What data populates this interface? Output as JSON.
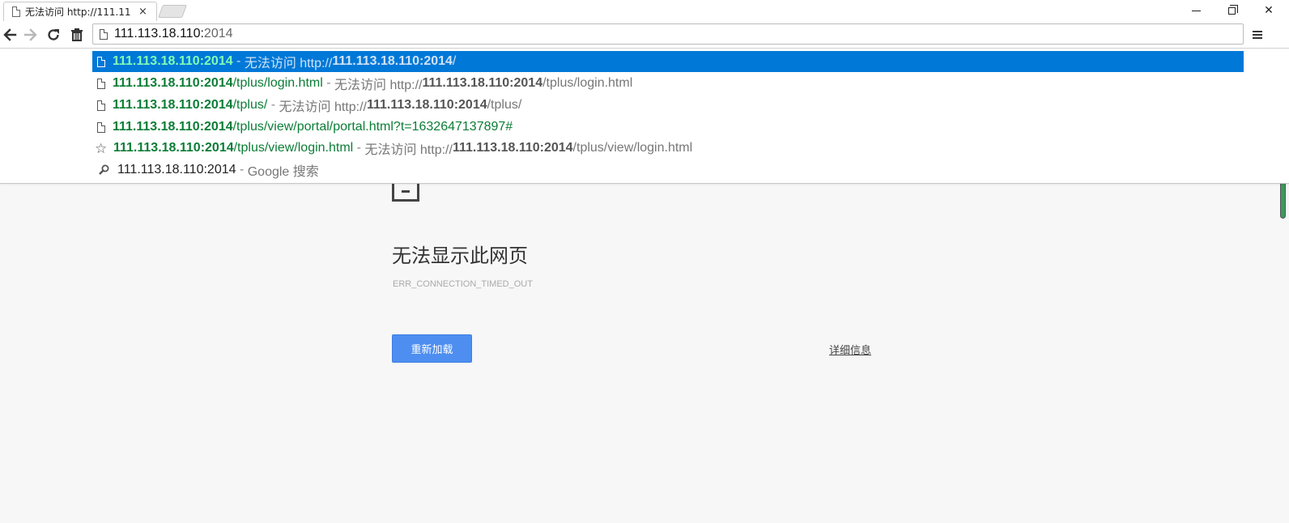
{
  "tab": {
    "title": "无法访问 http://111.113.",
    "close": "×"
  },
  "window": {
    "minimize": "minimize",
    "maximize": "restore",
    "close": "✕"
  },
  "omnibox": {
    "typed": "111.113.18.110:",
    "autocomplete": "2014"
  },
  "suggestions": [
    {
      "icon": "page-icon",
      "url_bold": "111.113.18.110:2014",
      "url_rest": "",
      "sep": " - ",
      "title_prefix": "无法访问 http://",
      "title_bold": "111.113.18.110:2014",
      "title_rest": "/",
      "selected": true
    },
    {
      "icon": "page-icon",
      "url_bold": "111.113.18.110:2014",
      "url_rest": "/tplus/login.html",
      "sep": " - ",
      "title_prefix": "无法访问 http://",
      "title_bold": "111.113.18.110:2014",
      "title_rest": "/tplus/login.html",
      "selected": false
    },
    {
      "icon": "page-icon",
      "url_bold": "111.113.18.110:2014",
      "url_rest": "/tplus/",
      "sep": " - ",
      "title_prefix": "无法访问 http://",
      "title_bold": "111.113.18.110:2014",
      "title_rest": "/tplus/",
      "selected": false
    },
    {
      "icon": "page-icon",
      "url_bold": "111.113.18.110:2014",
      "url_rest": "/tplus/view/portal/portal.html?t=1632647137897#",
      "sep": "",
      "title_prefix": "",
      "title_bold": "",
      "title_rest": "",
      "selected": false
    },
    {
      "icon": "star-icon",
      "url_bold": "111.113.18.110:2014",
      "url_rest": "/tplus/view/login.html",
      "sep": " - ",
      "title_prefix": "无法访问 http://",
      "title_bold": "111.113.18.110:2014",
      "title_rest": "/tplus/view/login.html",
      "selected": false
    }
  ],
  "search_suggestion": {
    "query": "111.113.18.110:2014",
    "sep": " - ",
    "engine": "Google 搜索"
  },
  "error_page": {
    "title": "无法显示此网页",
    "code": "ERR_CONNECTION_TIMED_OUT",
    "reload_label": "重新加载",
    "details_label": "详细信息"
  },
  "colors": {
    "selection": "#0078d7",
    "url_green": "#0b7d36",
    "button_blue": "#4d8ef0"
  }
}
